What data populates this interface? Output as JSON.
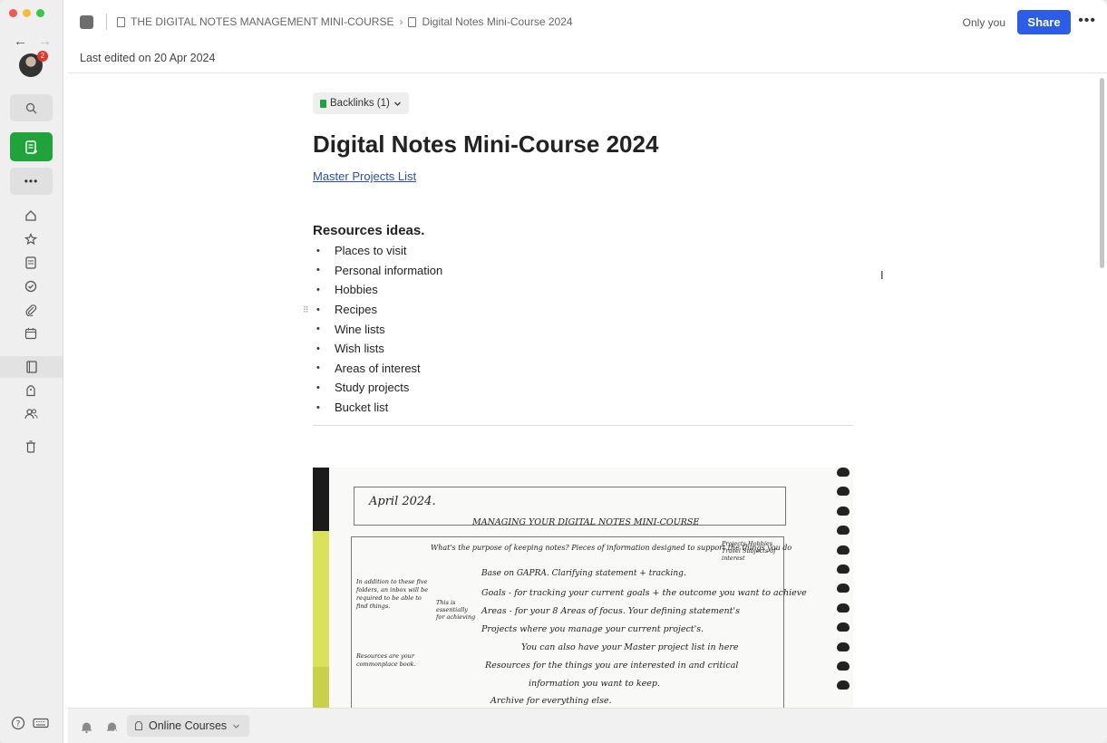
{
  "colors": {
    "accent_green": "#1fa33a",
    "share_blue": "#2d5ce5",
    "link_blue": "#2b4fb5",
    "badge_red": "#e0362c"
  },
  "sidebar": {
    "notification_count": "2",
    "icons": [
      "search-icon",
      "new-note-icon",
      "more-icon",
      "home-icon",
      "shortcuts-star-icon",
      "notes-icon",
      "tasks-icon",
      "files-icon",
      "calendar-icon",
      "notebooks-icon",
      "tags-icon",
      "shared-icon",
      "trash-icon"
    ],
    "more_label": "•••"
  },
  "header": {
    "breadcrumb_notebook": "THE DIGITAL NOTES MANAGEMENT MINI-COURSE",
    "breadcrumb_separator": "›",
    "breadcrumb_note": "Digital Notes Mini-Course 2024",
    "visibility": "Only you",
    "share_label": "Share",
    "more_label": "•••",
    "last_edited": "Last edited on 20 Apr 2024"
  },
  "note": {
    "backlinks_label": "Backlinks (1)",
    "title": "Digital Notes Mini-Course 2024",
    "link_text": "Master Projects List",
    "section_heading": "Resources ideas.",
    "bullet_char": "•",
    "items": [
      "Places to visit",
      "Personal information",
      "Hobbies",
      "Recipes",
      "Wine lists",
      "Wish lists",
      "Areas of interest",
      "Study projects",
      "Bucket list"
    ]
  },
  "handwritten": {
    "date": "April 2024.",
    "heading": "MANAGING YOUR DIGITAL NOTES MINI-COURSE",
    "lines": [
      "What's the purpose of keeping notes? Pieces of information designed to support the things you do",
      "Base on GAPRA. Clarifying statement + tracking.",
      "Goals - for tracking your current goals + the outcome you want to achieve",
      "Areas - for your 8 Areas of focus. Your defining statement's",
      "Projects where you manage your current project's.",
      "You can also have your Master project list in here",
      "Resources for the things you are interested in and critical",
      "information you want to keep.",
      "Archive for everything else."
    ],
    "side_notes": [
      "In addition to these five folders, an inbox will be required to be able to find things.",
      "Resources are your commonplace book.",
      "This is essentially for achieving",
      "Projects Hobbies Travel Subjects of interest"
    ]
  },
  "footer": {
    "notebook_name": "Online Courses"
  }
}
